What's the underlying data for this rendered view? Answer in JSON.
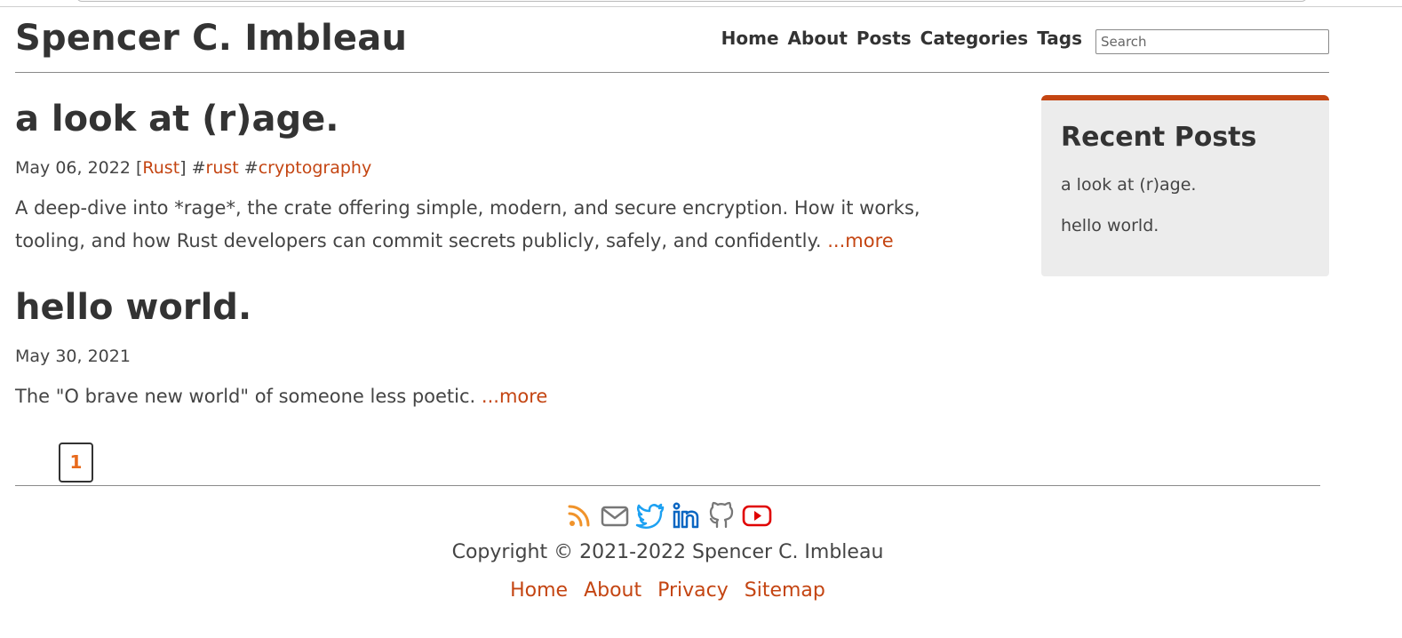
{
  "site": {
    "title": "Spencer C. Imbleau"
  },
  "nav": [
    {
      "label": "Home"
    },
    {
      "label": "About"
    },
    {
      "label": "Posts"
    },
    {
      "label": "Categories"
    },
    {
      "label": "Tags"
    }
  ],
  "search": {
    "placeholder": "Search",
    "value": ""
  },
  "posts": [
    {
      "title": "a look at (r)age.",
      "date": "May 06, 2022",
      "category": "Rust",
      "tags": [
        "rust",
        "cryptography"
      ],
      "summary": "A deep-dive into *rage*, the crate offering simple, modern, and secure encryption. How it works, tooling, and how Rust developers can commit secrets publicly, safely, and confidently.",
      "more_label": "...more"
    },
    {
      "title": "hello world.",
      "date": "May 30, 2021",
      "summary": "The \"O brave new world\" of someone less poetic.",
      "more_label": "...more"
    }
  ],
  "pagination": {
    "current_page": "1"
  },
  "sidebar": {
    "title": "Recent Posts",
    "items": [
      "a look at (r)age.",
      "hello world."
    ]
  },
  "footer": {
    "social_icons": [
      "rss-icon",
      "email-icon",
      "twitter-icon",
      "linkedin-icon",
      "github-icon",
      "youtube-icon"
    ],
    "copyright": "Copyright © 2021-2022 Spencer C. Imbleau",
    "links": [
      "Home",
      "About",
      "Privacy",
      "Sitemap"
    ]
  },
  "colors": {
    "accent": "#c44512",
    "page_number": "#e86a1c",
    "rss": "#f0932b",
    "twitter": "#1da1f2",
    "linkedin": "#0a66c2",
    "youtube": "#e00000",
    "icon_gray": "#777777"
  }
}
